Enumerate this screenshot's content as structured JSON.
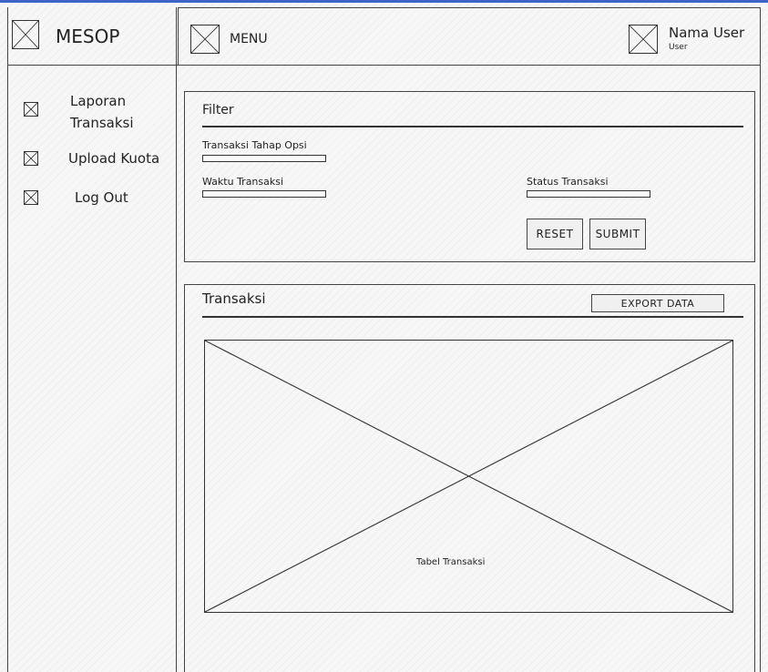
{
  "app": {
    "brand": "MESOP"
  },
  "header": {
    "menu_label": "MENU",
    "user_name": "Nama User",
    "user_role": "User"
  },
  "sidebar": {
    "items": [
      {
        "label_line1": "Laporan",
        "label_line2": "Transaksi"
      },
      {
        "label": "Upload Kuota"
      },
      {
        "label": "Log Out"
      }
    ]
  },
  "filter": {
    "title": "Filter",
    "field1_label": "Transaksi Tahap Opsi",
    "field2_label": "Waktu Transaksi",
    "field3_label": "Status Transaksi",
    "reset_label": "RESET",
    "submit_label": "SUBMIT"
  },
  "transaksi": {
    "title": "Transaksi",
    "export_label": "EXPORT DATA",
    "table_placeholder": "Tabel Transaksi"
  }
}
